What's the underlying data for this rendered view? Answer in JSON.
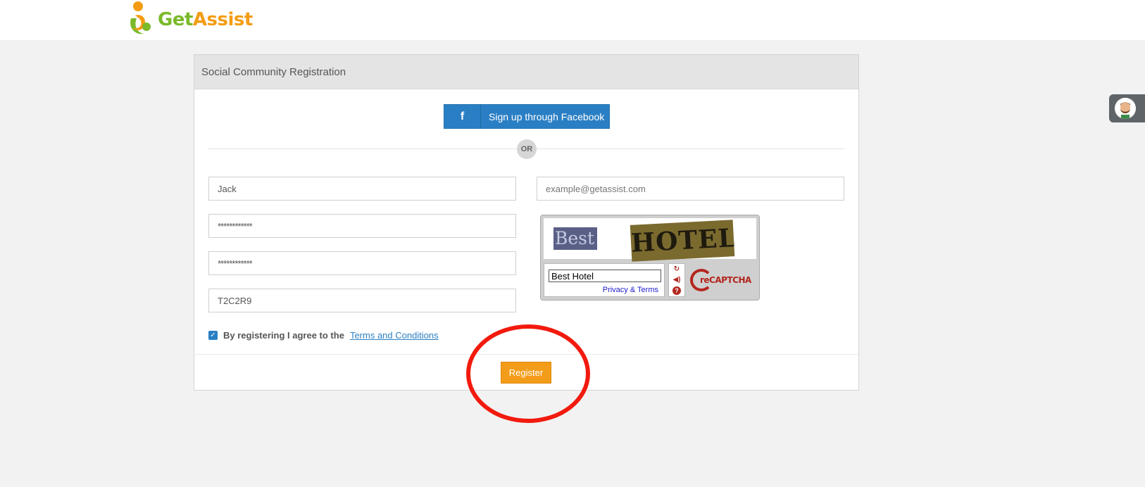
{
  "logo": {
    "text_g": "Get",
    "text_a": "Assist"
  },
  "card": {
    "title": "Social Community Registration"
  },
  "facebook": {
    "icon": "f",
    "label": "Sign up through Facebook"
  },
  "divider": {
    "or": "OR"
  },
  "fields": {
    "name_value": "Jack",
    "email_placeholder": "example@getassist.com",
    "password_value": "************",
    "confirm_password_value": "************",
    "postal_value": "T2C2R9"
  },
  "captcha": {
    "word1": "Best",
    "word2": "HOTEL",
    "response_value": "Best Hotel",
    "privacy_label": "Privacy & Terms",
    "logo_text": "reCAPTCHA",
    "tool_refresh": "↻",
    "tool_audio": "◀)",
    "tool_help": "?"
  },
  "terms": {
    "check": "✓",
    "text": "By registering I agree to the",
    "link": "Terms and Conditions"
  },
  "register": {
    "label": "Register"
  },
  "colors": {
    "brand_green": "#7ab929",
    "brand_orange": "#f39c12",
    "facebook_blue": "#2a7fc4",
    "register_orange": "#f39c1a",
    "annotation_red": "#f21a0e"
  }
}
